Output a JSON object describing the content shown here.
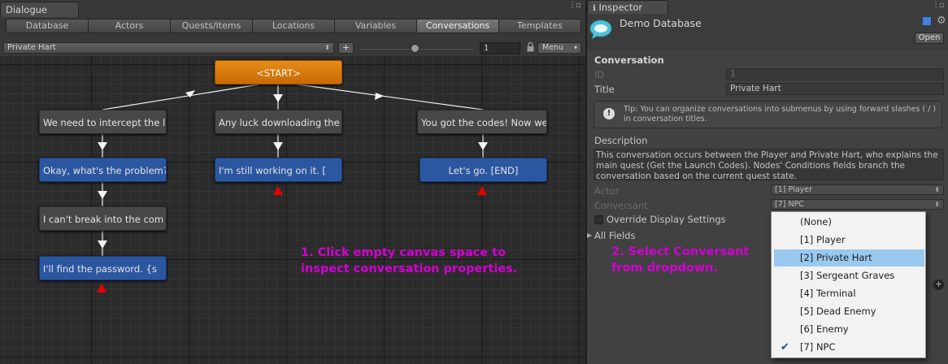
{
  "dialogue": {
    "window_tab": "Dialogue",
    "tabs": [
      "Database",
      "Actors",
      "Quests/Items",
      "Locations",
      "Variables",
      "Conversations",
      "Templates"
    ],
    "active_tab": "Conversations",
    "conversation_select": "Private Hart",
    "add_label": "+",
    "zoom_value": "1",
    "menu_label": "Menu",
    "nodes": {
      "start": "<START>",
      "n1": "We need to intercept the l",
      "n2": "Any luck downloading the l",
      "n3": "You got the codes! Now we",
      "p1": "Okay, what's the problem?",
      "p2": "I'm still working on it. [",
      "p3": "Let's go. [END]",
      "n4": "I can't break into the com",
      "p4": "I'll find the password. {s"
    },
    "callout1": [
      "1. Click empty canvas space to",
      "inspect conversation properties."
    ]
  },
  "inspector": {
    "tab_label": "Inspector",
    "db_title": "Demo Database",
    "open_label": "Open",
    "section": "Conversation",
    "id_label": "ID",
    "id_value": "1",
    "title_label": "Title",
    "title_value": "Private Hart",
    "tip": "Tip: You can organize conversations into submenus by using forward slashes ( / ) in conversation titles.",
    "description_label": "Description",
    "description": "This conversation occurs between the Player and Private Hart, who explains the main quest (Get the Launch Codes). Nodes' Conditions fields branch the conversation based on the current quest state.",
    "actor_label": "Actor",
    "actor_value": "[1] Player",
    "conversant_label": "Conversant",
    "conversant_value": "[7] NPC",
    "override_label": "Override Display Settings",
    "all_fields_label": "All Fields",
    "callout2": [
      "2. Select Conversant",
      "from dropdown."
    ],
    "conversant_options": [
      "(None)",
      "[1] Player",
      "[2] Private Hart",
      "[3] Sergeant Graves",
      "[4] Terminal",
      "[5] Dead Enemy",
      "[6] Enemy",
      "[7] NPC"
    ],
    "highlighted_option": "[2] Private Hart",
    "checked_option": "[7] NPC"
  },
  "colors": {
    "start_node": "#d9780c",
    "npc_node": "#484848",
    "player_node": "#2b57a0",
    "callout": "#d400d4",
    "end_marker": "#e60000",
    "popup_highlight": "#99c9ef"
  }
}
